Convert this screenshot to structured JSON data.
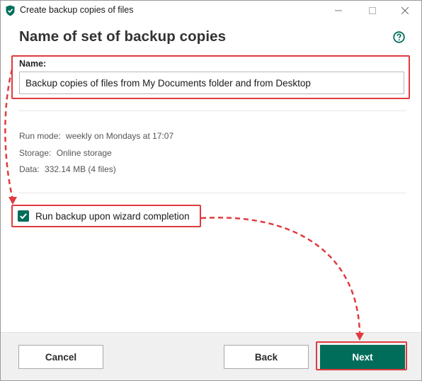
{
  "window": {
    "title": "Create backup copies of files",
    "minimize_glyph": "—",
    "maximize_glyph": "☐",
    "close_glyph": "✕"
  },
  "header": {
    "title": "Name of set of backup copies",
    "help_icon": "help-circle-icon"
  },
  "name_field": {
    "label": "Name:",
    "value": "Backup copies of files from My Documents folder and from Desktop"
  },
  "summary": [
    {
      "label": "Run mode:",
      "value": "weekly on Mondays at 17:07"
    },
    {
      "label": "Storage:",
      "value": "Online storage"
    },
    {
      "label": "Data:",
      "value": "332.14 MB (4 files)"
    }
  ],
  "run_backup": {
    "checked": true,
    "label": "Run backup upon wizard completion"
  },
  "footer": {
    "cancel_label": "Cancel",
    "back_label": "Back",
    "next_label": "Next"
  },
  "colors": {
    "accent": "#006d5b",
    "annotation": "#e03a3e"
  }
}
